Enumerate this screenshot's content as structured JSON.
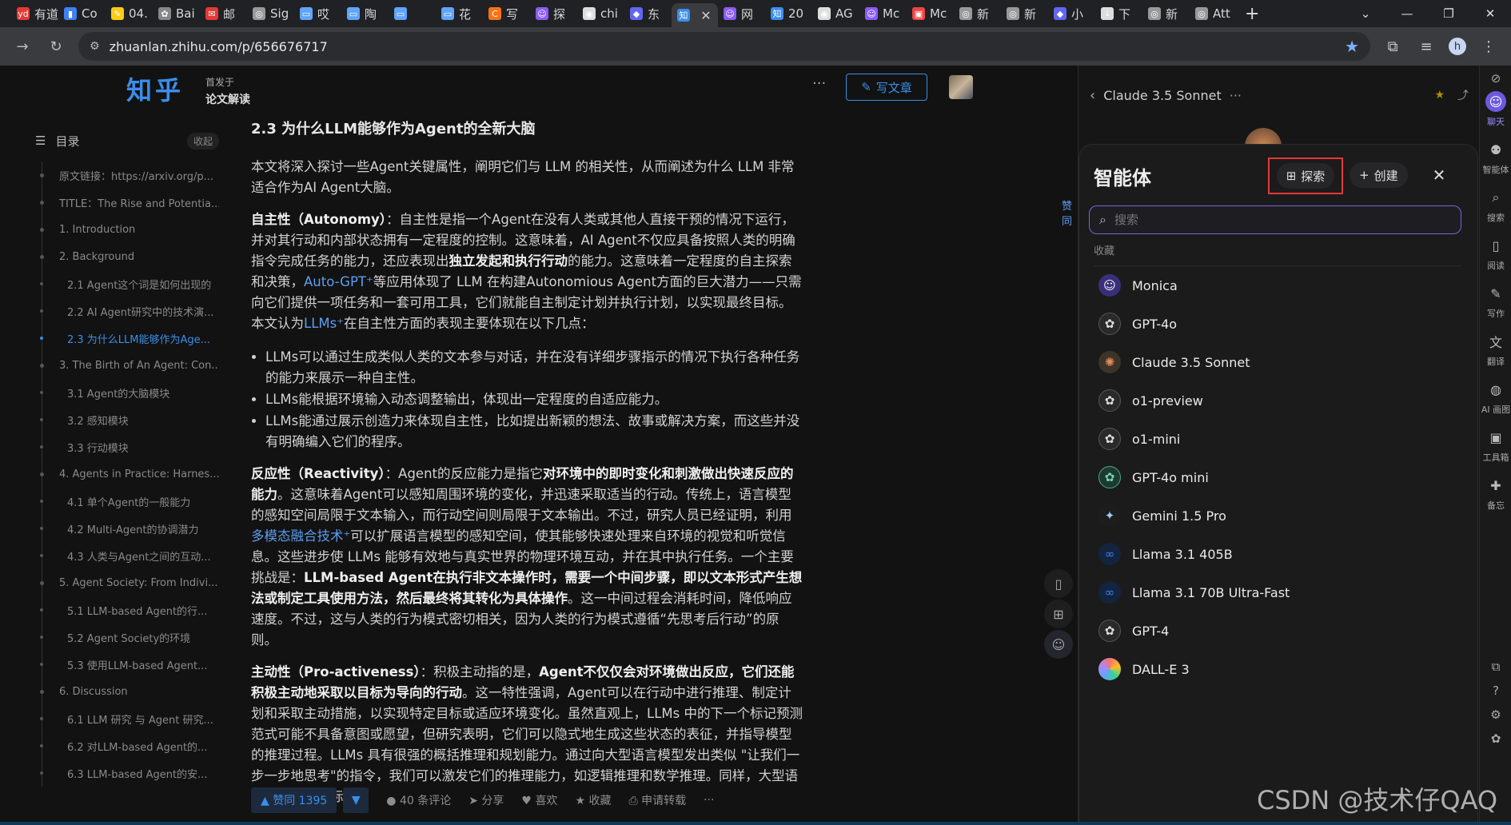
{
  "browser": {
    "tabs": [
      {
        "label": "有道",
        "icon": "youdao-icon",
        "color": "#e53935"
      },
      {
        "label": "Co",
        "icon": "analytics-icon",
        "color": "#3b82f6"
      },
      {
        "label": "04.",
        "icon": "note-icon",
        "color": "#facc15"
      },
      {
        "label": "Bai",
        "icon": "openai-icon",
        "color": "#888888"
      },
      {
        "label": "邮",
        "icon": "mail-icon",
        "color": "#e53935"
      },
      {
        "label": "Sig",
        "icon": "globe-icon",
        "color": "#999999"
      },
      {
        "label": "哎",
        "icon": "tv-icon",
        "color": "#60a5fa"
      },
      {
        "label": "陶",
        "icon": "tv-icon",
        "color": "#60a5fa"
      },
      {
        "label": "",
        "icon": "tv-icon",
        "color": "#60a5fa"
      },
      {
        "label": "花",
        "icon": "tv-icon",
        "color": "#60a5fa"
      },
      {
        "label": "写",
        "icon": "c-icon",
        "color": "#f97316"
      },
      {
        "label": "探",
        "icon": "monica-icon",
        "color": "#8b5cf6"
      },
      {
        "label": "chi",
        "icon": "github-icon",
        "color": "#dddddd"
      },
      {
        "label": "东",
        "icon": "app-icon",
        "color": "#6366f1"
      },
      {
        "label": "",
        "icon": "zhihu-icon",
        "color": "#3b8eea"
      },
      {
        "label": "网",
        "icon": "monica-icon",
        "color": "#8b5cf6"
      },
      {
        "label": "20",
        "icon": "zhihu-icon",
        "color": "#3b8eea"
      },
      {
        "label": "AG",
        "icon": "github-icon",
        "color": "#dddddd"
      },
      {
        "label": "Mc",
        "icon": "monica-icon",
        "color": "#8b5cf6"
      },
      {
        "label": "Mc",
        "icon": "image-icon",
        "color": "#ef4444"
      },
      {
        "label": "新",
        "icon": "globe-icon",
        "color": "#999999"
      },
      {
        "label": "新",
        "icon": "globe-icon",
        "color": "#999999"
      },
      {
        "label": "小",
        "icon": "app-icon",
        "color": "#6366f1"
      },
      {
        "label": "下",
        "icon": "download-icon",
        "color": "#dddddd"
      },
      {
        "label": "新",
        "icon": "globe-icon",
        "color": "#999999"
      },
      {
        "label": "Att",
        "icon": "globe-icon",
        "color": "#999999"
      }
    ],
    "active_tab_index": 14,
    "new_tab": "+",
    "url": "zhuanlan.zhihu.com/p/656676717",
    "profile_initial": "h",
    "window_controls": [
      "⌄",
      "—",
      "❐",
      "✕"
    ]
  },
  "zhihu": {
    "logo": "知乎",
    "published_in_label": "首发于",
    "column_name": "论文解读",
    "write_button": "写文章",
    "catalog_title": "目录",
    "catalog_fold": "收起",
    "catalog": [
      {
        "text": "原文链接：https://arxiv.org/p...",
        "level": 1
      },
      {
        "text": "TITLE：The Rise and Potentia...",
        "level": 1
      },
      {
        "text": "1. Introduction",
        "level": 1
      },
      {
        "text": "2. Background",
        "level": 1
      },
      {
        "text": "2.1 Agent这个词是如何出现的",
        "level": 2
      },
      {
        "text": "2.2 AI Agent研究中的技术演...",
        "level": 2
      },
      {
        "text": "2.3 为什么LLM能够作为Age...",
        "level": 2,
        "active": true
      },
      {
        "text": "3. The Birth of An Agent: Con...",
        "level": 1
      },
      {
        "text": "3.1 Agent的大脑模块",
        "level": 2
      },
      {
        "text": "3.2 感知模块",
        "level": 2
      },
      {
        "text": "3.3 行动模块",
        "level": 2
      },
      {
        "text": "4. Agents in Practice: Harnes...",
        "level": 1
      },
      {
        "text": "4.1 单个Agent的一般能力",
        "level": 2
      },
      {
        "text": "4.2 Multi-Agent的协调潜力",
        "level": 2
      },
      {
        "text": "4.3 人类与Agent之间的互动...",
        "level": 2
      },
      {
        "text": "5. Agent Society: From Indivi...",
        "level": 1
      },
      {
        "text": "5.1 LLM-based Agent的行...",
        "level": 2
      },
      {
        "text": "5.2 Agent Society的环境",
        "level": 2
      },
      {
        "text": "5.3 使用LLM-based Agent...",
        "level": 2
      },
      {
        "text": "6. Discussion",
        "level": 1
      },
      {
        "text": "6.1 LLM 研究 与 Agent 研究...",
        "level": 2
      },
      {
        "text": "6.2 对LLM-based Agent的...",
        "level": 2
      },
      {
        "text": "6.3 LLM-based Agent的安...",
        "level": 2
      }
    ],
    "article": {
      "heading": "2.3 为什么LLM能够作为Agent的全新大脑",
      "intro": "本文将深入探讨一些Agent关键属性，阐明它们与 LLM 的相关性，从而阐述为什么 LLM 非常适合作为AI Agent大脑。",
      "p1_term": "自主性（Autonomy）",
      "p1_a": "：自主性是指一个Agent在没有人类或其他人直接干预的情况下运行，并对其行动和内部状态拥有一定程度的控制。这意味着，AI Agent不仅应具备按照人类的明确指令完成任务的能力，还应表现出",
      "p1_bold": "独立发起和执行行动",
      "p1_b": "的能力。这意味着一定程度的自主探索和决策，",
      "p1_link": "Auto-GPT⁺",
      "p1_c": "等应用体现了 LLM 在构建Autonomious Agent方面的巨大潜力——只需向它们提供一项任务和一套可用工具，它们就能自主制定计划并执行计划，以实现最终目标。本文认为",
      "p1_link2": "LLMs⁺",
      "p1_d": "在自主性方面的表现主要体现在以下几点：",
      "bullets": [
        "LLMs可以通过生成类似人类的文本参与对话，并在没有详细步骤指示的情况下执行各种任务的能力来展示一种自主性。",
        "LLMs能根据环境输入动态调整输出，体现出一定程度的自适应能力。",
        "LLMs能通过展示创造力来体现自主性，比如提出新颖的想法、故事或解决方案，而这些并没有明确编入它们的程序。"
      ],
      "p2_term": "反应性（Reactivity）",
      "p2_a": "：Agent的反应能力是指它",
      "p2_bold": "对环境中的即时变化和刺激做出快速反应的能力",
      "p2_b": "。这意味着Agent可以感知周围环境的变化，并迅速采取适当的行动。传统上，语言模型的感知空间局限于文本输入，而行动空间则局限于文本输出。不过，研究人员已经证明，利用",
      "p2_link": "多模态融合技术⁺",
      "p2_c": "可以扩展语言模型的感知空间，使其能够快速处理来自环境的视觉和听觉信息。这些进步使 LLMs 能够有效地与真实世界的物理环境互动，并在其中执行任务。一个主要挑战是：",
      "p2_bold2": "LLM-based Agent在执行非文本操作时，需要一个中间步骤，即以文本形式产生想法或制定工具使用方法，然后最终将其转化为具体操作",
      "p2_d": "。这一中间过程会消耗时间，降低响应速度。不过，这与人类的行为模式密切相关，因为人类的行为模式遵循“先思考后行动”的原则。",
      "p3_term": "主动性（Pro-activeness）",
      "p3_a": "：积极主动指的是，",
      "p3_bold": "Agent不仅仅会对环境做出反应，它们还能积极主动地采取以目标为导向的行动",
      "p3_b": "。这一特性强调，Agent可以在行动中进行推理、制定计划和采取主动措施，以实现特定目标或适应环境变化。虽然直观上，LLMs 中的下一个标记预测范式可能不具备意图或愿望，但研究表明，它们可以隐式地生成这些状态的表征，并指导模型的推理过程。LLMs 具有很强的概括推理和规划能力。通过向大型语言模型发出类似 \"让我们一步一步地思考\"的指令，我们可以激发它们的推理能力，如逻辑推理和数学推理。同样，大型语言模型也以目标"
    },
    "actions": {
      "upvote": "▲ 赞同 1395",
      "downvote": "▼",
      "comments": "40 条评论",
      "share": "分享",
      "like": "喜欢",
      "favorite": "收藏",
      "repost": "申请转载",
      "more": "···"
    },
    "side_label": "赞同"
  },
  "monica": {
    "bot_name": "Claude 3.5 Sonnet",
    "agent_panel": {
      "title": "智能体",
      "explore": "探索",
      "create": "创建",
      "search_placeholder": "搜索",
      "section": "收藏",
      "agents": [
        {
          "name": "Monica",
          "icon": "monica-icon",
          "style": "monica"
        },
        {
          "name": "GPT-4o",
          "icon": "openai-icon",
          "style": "openai"
        },
        {
          "name": "Claude 3.5 Sonnet",
          "icon": "claude-icon",
          "style": "claude"
        },
        {
          "name": "o1-preview",
          "icon": "openai-icon",
          "style": "openai"
        },
        {
          "name": "o1-mini",
          "icon": "openai-icon",
          "style": "openai"
        },
        {
          "name": "GPT-4o mini",
          "icon": "openai-icon",
          "style": "openai-green"
        },
        {
          "name": "Gemini 1.5 Pro",
          "icon": "gemini-icon",
          "style": "gemini"
        },
        {
          "name": "Llama 3.1 405B",
          "icon": "meta-icon",
          "style": "meta"
        },
        {
          "name": "Llama 3.1 70B Ultra-Fast",
          "icon": "meta-icon",
          "style": "meta"
        },
        {
          "name": "GPT-4",
          "icon": "openai-icon",
          "style": "openai"
        },
        {
          "name": "DALL-E 3",
          "icon": "dalle-icon",
          "style": "dalle"
        }
      ]
    },
    "rail": [
      {
        "label": "聊天",
        "icon": "chat-icon",
        "active": true
      },
      {
        "label": "智能体",
        "icon": "robot-icon"
      },
      {
        "label": "搜索",
        "icon": "search-icon"
      },
      {
        "label": "阅读",
        "icon": "book-icon"
      },
      {
        "label": "写作",
        "icon": "pen-icon"
      },
      {
        "label": "翻译",
        "icon": "translate-icon"
      },
      {
        "label": "AI 画图",
        "icon": "palette-icon"
      },
      {
        "label": "工具箱",
        "icon": "toolbox-icon"
      },
      {
        "label": "备忘",
        "icon": "memo-icon"
      }
    ]
  },
  "watermark": "CSDN @技术仔QAQ"
}
